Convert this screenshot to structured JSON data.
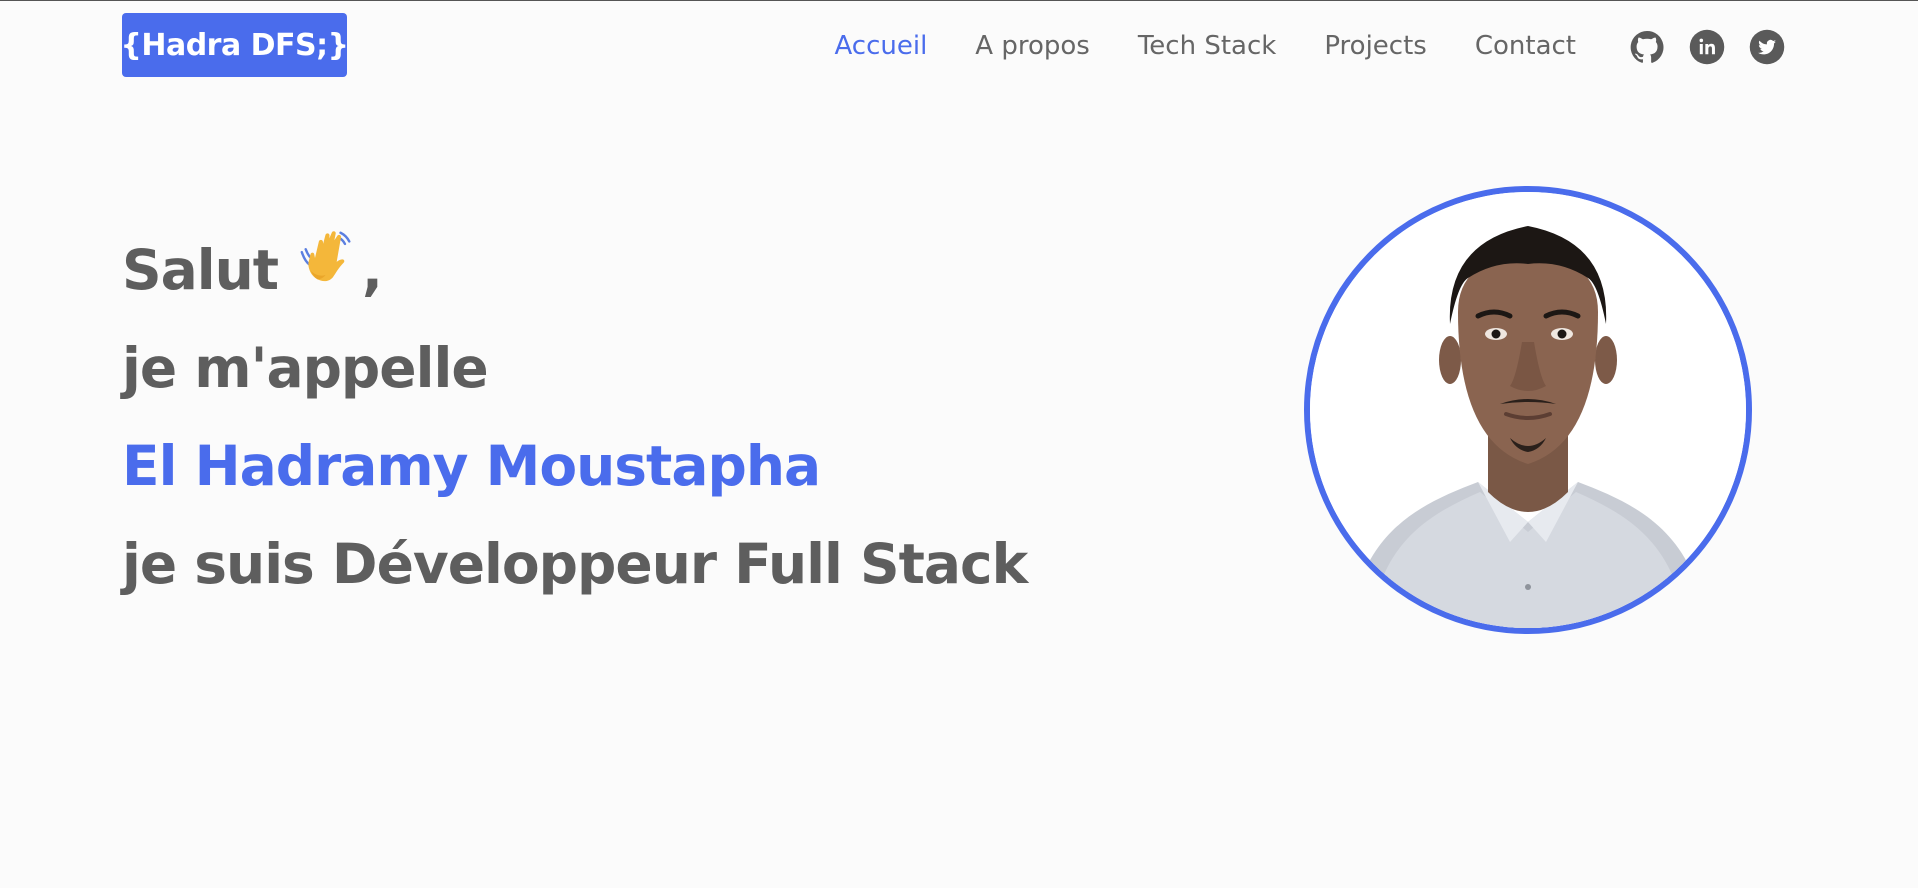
{
  "brand": {
    "logo_text": "{Hadra DFS;}",
    "accent_color": "#4a6cec",
    "text_color": "#5e5e5e"
  },
  "nav": {
    "links": [
      {
        "label": "Accueil",
        "active": true
      },
      {
        "label": "A propos",
        "active": false
      },
      {
        "label": "Tech Stack",
        "active": false
      },
      {
        "label": "Projects",
        "active": false
      },
      {
        "label": "Contact",
        "active": false
      }
    ],
    "socials": [
      {
        "icon": "github-icon"
      },
      {
        "icon": "linkedin-icon"
      },
      {
        "icon": "twitter-icon"
      }
    ]
  },
  "hero": {
    "greeting": "Salut",
    "greeting_suffix": ",",
    "wave_icon": "waving-hand-icon",
    "line2": "je m'appelle",
    "name": "El Hadramy Moustapha",
    "line4": "je suis Développeur Full Stack"
  },
  "profile": {
    "image_icon": "profile-photo"
  }
}
